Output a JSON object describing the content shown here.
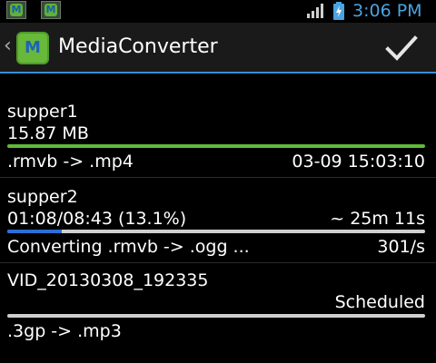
{
  "status_bar": {
    "time": "3:06 PM",
    "notification_icons": [
      "media-converter-icon",
      "media-converter-icon"
    ],
    "signal_icon": "signal-icon",
    "battery_icon": "battery-charging-icon",
    "colors": {
      "clock": "#4aa4e0"
    }
  },
  "action_bar": {
    "title": "MediaConverter",
    "logo_letter": "M",
    "done_icon": "checkmark-icon",
    "colors": {
      "accent": "#3a8ed6"
    }
  },
  "tasks": [
    {
      "name": "supper1",
      "detail_left": "15.87 MB",
      "detail_right": "",
      "progress": 1.0,
      "bar_color": "#5fba3a",
      "footer_left": ".rmvb -> .mp4",
      "footer_right": "03-09 15:03:10"
    },
    {
      "name": "supper2",
      "detail_left": "01:08/08:43 (13.1%)",
      "detail_right": "~ 25m 11s",
      "progress": 0.131,
      "bar_color": "#2a6fd6",
      "footer_left": "Converting .rmvb -> .ogg ...",
      "footer_right": "301/s"
    },
    {
      "name": "VID_20130308_192335",
      "detail_left": "",
      "detail_right": "Scheduled",
      "progress": 0.0,
      "bar_color": "#cfcfcf",
      "footer_left": ".3gp -> .mp3",
      "footer_right": ""
    }
  ]
}
